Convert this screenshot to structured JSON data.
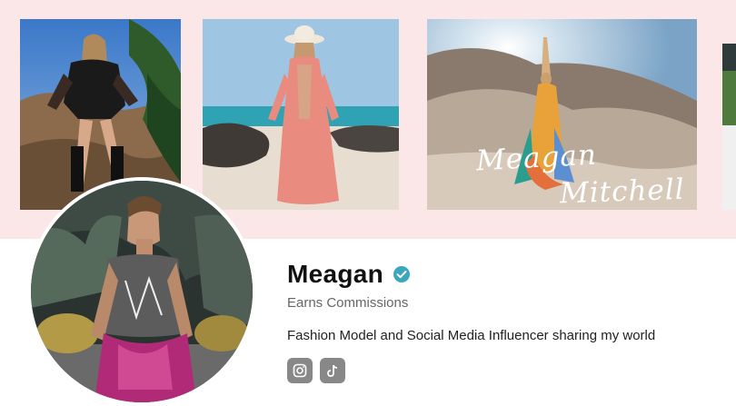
{
  "profile": {
    "name": "Meagan",
    "subtitle": "Earns Commissions",
    "bio": "Fashion Model and Social Media Influencer sharing my world"
  },
  "banner": {
    "photos": [
      {
        "description": "model in black bodysuit and boots on rocky hill"
      },
      {
        "description": "woman in pink dress and hat on beach"
      },
      {
        "description": "woman in colorful dress on sand dune"
      },
      {
        "description": "partial landscape photo"
      }
    ],
    "signature_line1": "Meagan",
    "signature_line2": "Mitchell"
  },
  "socials": [
    {
      "icon": "instagram-icon"
    },
    {
      "icon": "tiktok-icon"
    }
  ],
  "colors": {
    "banner_bg": "#fbe7e7",
    "verified_badge": "#3aa7bf",
    "social_button": "#888888"
  }
}
